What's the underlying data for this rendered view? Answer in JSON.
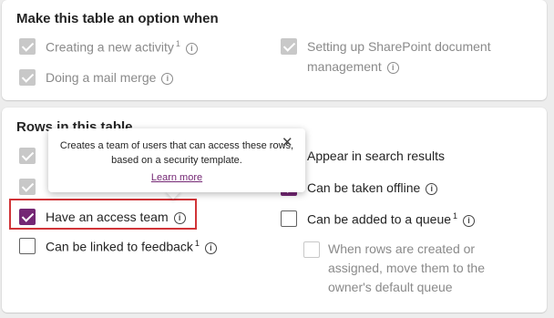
{
  "section_options": {
    "title": "Make this table an option when",
    "items": [
      {
        "label": "Creating a new activity",
        "sup": "1",
        "checked": true,
        "disabled": true
      },
      {
        "label": "Doing a mail merge",
        "checked": true,
        "disabled": true
      },
      {
        "label": "Setting up SharePoint document management",
        "checked": true,
        "disabled": true
      }
    ]
  },
  "section_rows": {
    "title": "Rows in this table",
    "items": [
      {
        "label": "Have an access team",
        "checked": true
      },
      {
        "label": "Can be linked to feedback",
        "sup": "1",
        "checked": false
      },
      {
        "label": "Appear in search results",
        "checked": true
      },
      {
        "label": "Can be taken offline",
        "checked": true
      },
      {
        "label": "Can be added to a queue",
        "sup": "1",
        "checked": false
      },
      {
        "label": "When rows are created or assigned, move them to the owner's default queue",
        "checked": false,
        "disabled": true
      }
    ]
  },
  "tooltip": {
    "text": "Creates a team of users that can access these rows, based on a security template.",
    "link": "Learn more",
    "close_glyph": "✕"
  },
  "info_glyph": "i",
  "colors": {
    "accent": "#742774",
    "highlight": "#d13438",
    "disabled": "#c8c8c8"
  }
}
